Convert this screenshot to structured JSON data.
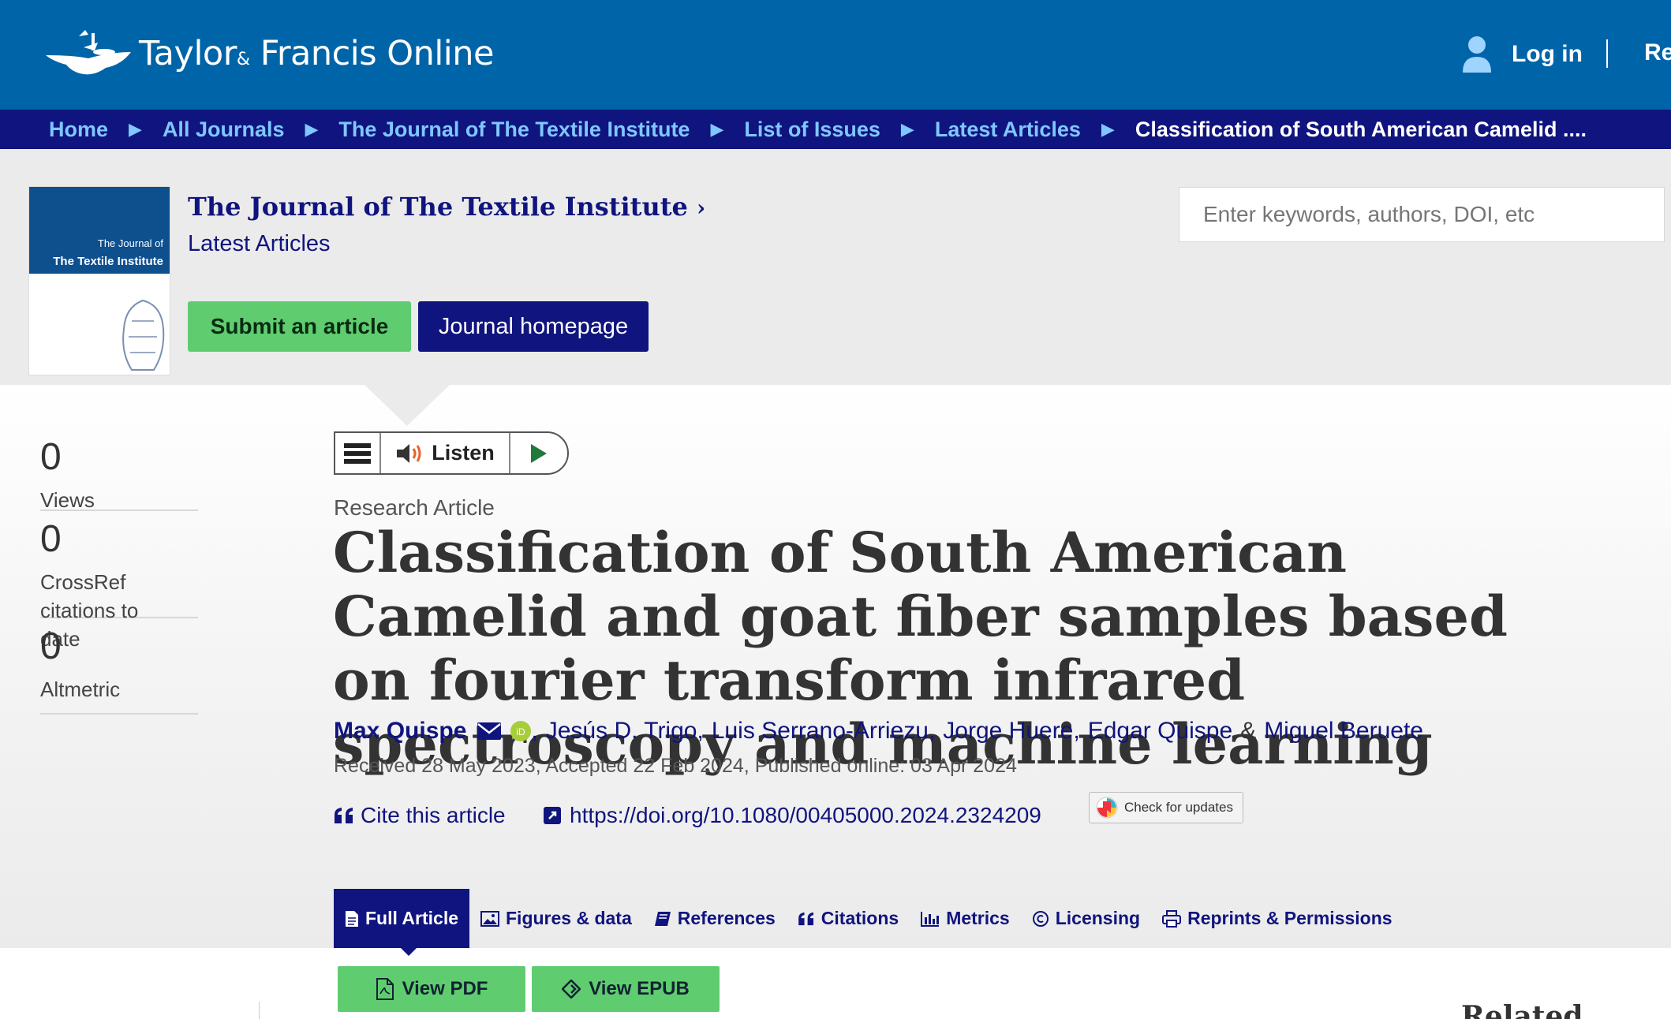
{
  "header": {
    "logo_text": "Taylor",
    "logo_amp": "&",
    "logo_text2": "Francis Online",
    "login_label": "Log in",
    "register_label": "Re"
  },
  "breadcrumb": [
    "Home",
    "All Journals",
    "The Journal of The Textile Institute",
    "List of Issues",
    "Latest Articles",
    "Classification of South American Camelid ...."
  ],
  "journal": {
    "cover_line1": "The Journal of",
    "cover_line2": "The Textile Institute",
    "title": "The Journal of The Textile Institute",
    "subtitle": "Latest Articles",
    "submit_label": "Submit an article",
    "homepage_label": "Journal homepage"
  },
  "search": {
    "placeholder": "Enter keywords, authors, DOI, etc"
  },
  "stats": [
    {
      "value": "0",
      "label": "Views"
    },
    {
      "value": "0",
      "label": "CrossRef citations to date"
    },
    {
      "value": "0",
      "label": "Altmetric"
    }
  ],
  "listen": {
    "label": "Listen"
  },
  "article": {
    "type": "Research Article",
    "title": "Classification of South American Camelid and goat fiber samples based on fourier transform infrared spectroscopy and machine learning",
    "authors": [
      "Max Quispe",
      "Jesús D. Trigo",
      "Luis Serrano-Arriezu",
      "Jorge Huere",
      "Edgar Quispe",
      "Miguel Beruete"
    ],
    "dates": "Received 28 May 2023, Accepted 22 Feb 2024, Published online: 03 Apr 2024",
    "cite_label": "Cite this article",
    "doi": "https://doi.org/10.1080/00405000.2024.2324209",
    "check_updates": "Check for updates"
  },
  "tabs": [
    "Full Article",
    "Figures & data",
    "References",
    "Citations",
    "Metrics",
    "Licensing",
    "Reprints & Permissions"
  ],
  "actions": {
    "pdf_label": "View PDF",
    "epub_label": "View EPUB"
  },
  "related_label": "Related",
  "colors": {
    "header_blue": "#0064a8",
    "navy": "#10147e",
    "green": "#5fcd6f",
    "crumb_link": "#7fc7ff"
  }
}
